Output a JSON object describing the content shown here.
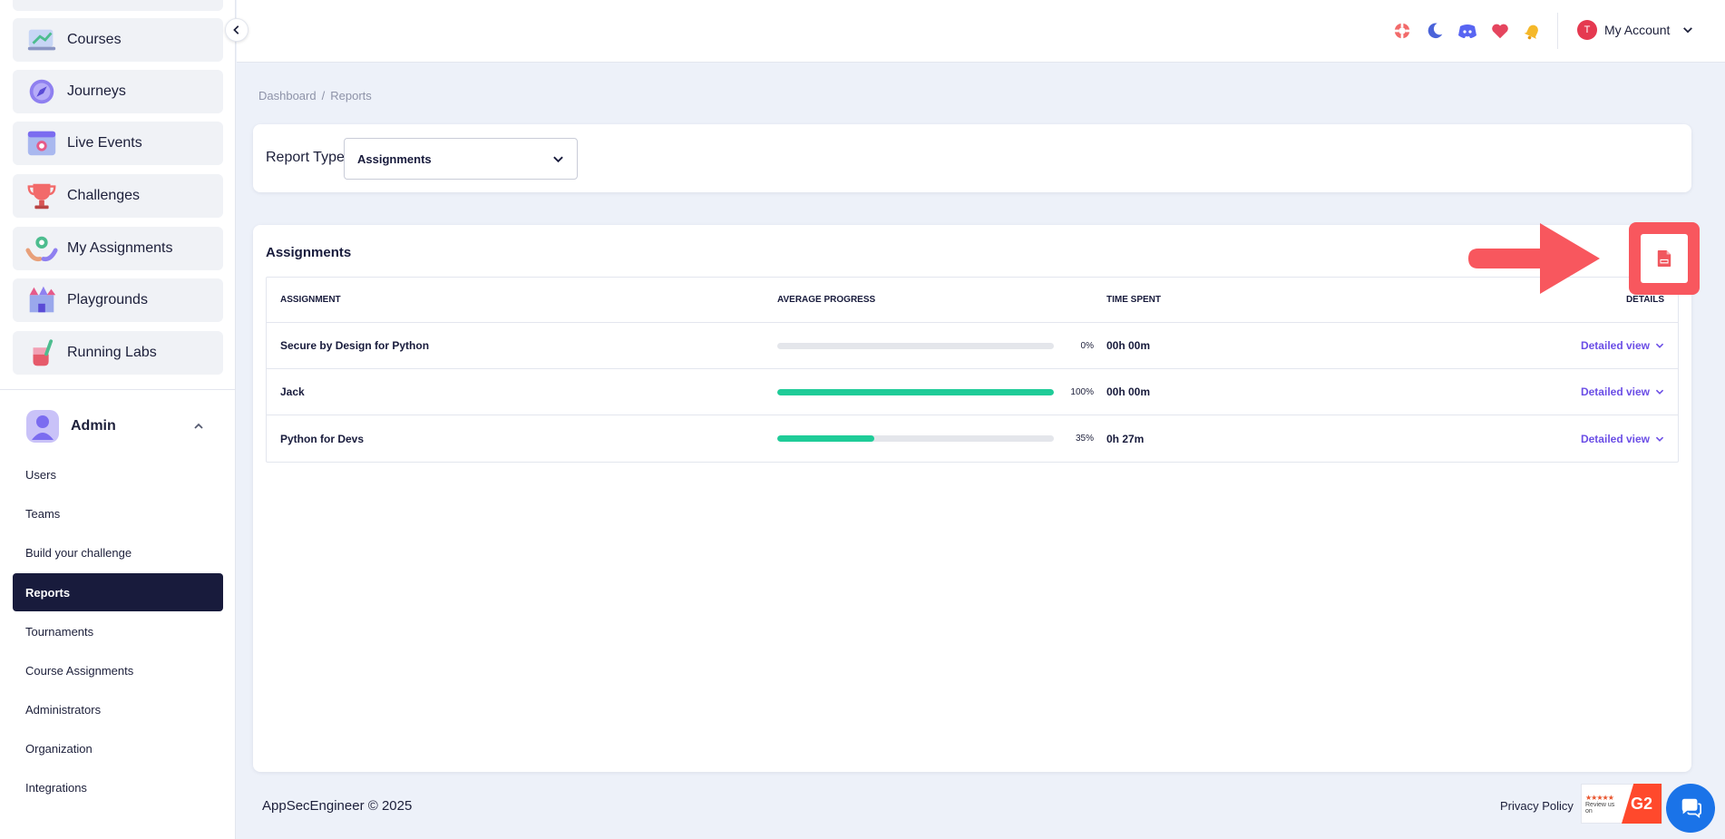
{
  "sidebar": {
    "nav_items": [
      {
        "label": "Courses",
        "icon": "courses-icon"
      },
      {
        "label": "Journeys",
        "icon": "compass-icon"
      },
      {
        "label": "Live Events",
        "icon": "live-events-icon"
      },
      {
        "label": "Challenges",
        "icon": "trophy-icon"
      },
      {
        "label": "My Assignments",
        "icon": "assignments-icon"
      },
      {
        "label": "Playgrounds",
        "icon": "playground-icon"
      },
      {
        "label": "Running Labs",
        "icon": "lab-icon"
      }
    ],
    "admin": {
      "label": "Admin",
      "items": [
        {
          "label": "Users"
        },
        {
          "label": "Teams"
        },
        {
          "label": "Build your challenge"
        },
        {
          "label": "Reports"
        },
        {
          "label": "Tournaments"
        },
        {
          "label": "Course Assignments"
        },
        {
          "label": "Administrators"
        },
        {
          "label": "Organization"
        },
        {
          "label": "Integrations"
        }
      ],
      "active_item": "Reports"
    }
  },
  "topbar": {
    "icons": [
      "lifebuoy-icon",
      "moon-icon",
      "discord-icon",
      "heart-icon",
      "bell-icon"
    ],
    "account_initial": "T",
    "account_label": "My Account"
  },
  "breadcrumb": {
    "home": "Dashboard",
    "separator": "/",
    "current": "Reports"
  },
  "filter": {
    "label": "Report Type",
    "selected": "Assignments"
  },
  "table": {
    "title": "Assignments",
    "headers": {
      "assignment": "ASSIGNMENT",
      "progress": "AVERAGE PROGRESS",
      "time": "TIME SPENT",
      "details": "DETAILS"
    },
    "rows": [
      {
        "name": "Secure by Design for Python",
        "progress": 0,
        "progress_label": "0%",
        "time": "00h 00m",
        "details": "Detailed view"
      },
      {
        "name": "Jack",
        "progress": 100,
        "progress_label": "100%",
        "time": "00h 00m",
        "details": "Detailed view"
      },
      {
        "name": "Python for Devs",
        "progress": 35,
        "progress_label": "35%",
        "time": "0h 27m",
        "details": "Detailed view"
      }
    ]
  },
  "csv_button": {
    "icon": "csv-file-icon"
  },
  "footer": {
    "copyright": "AppSecEngineer © 2025",
    "privacy": "Privacy Policy",
    "g2_stars": "★★★★★",
    "g2_text": "Review us on",
    "g2_logo": "G2"
  },
  "colors": {
    "accent": "#6b4ee6",
    "progress": "#1fcc98",
    "active_nav": "#181b3c",
    "highlight": "#f8575e"
  }
}
